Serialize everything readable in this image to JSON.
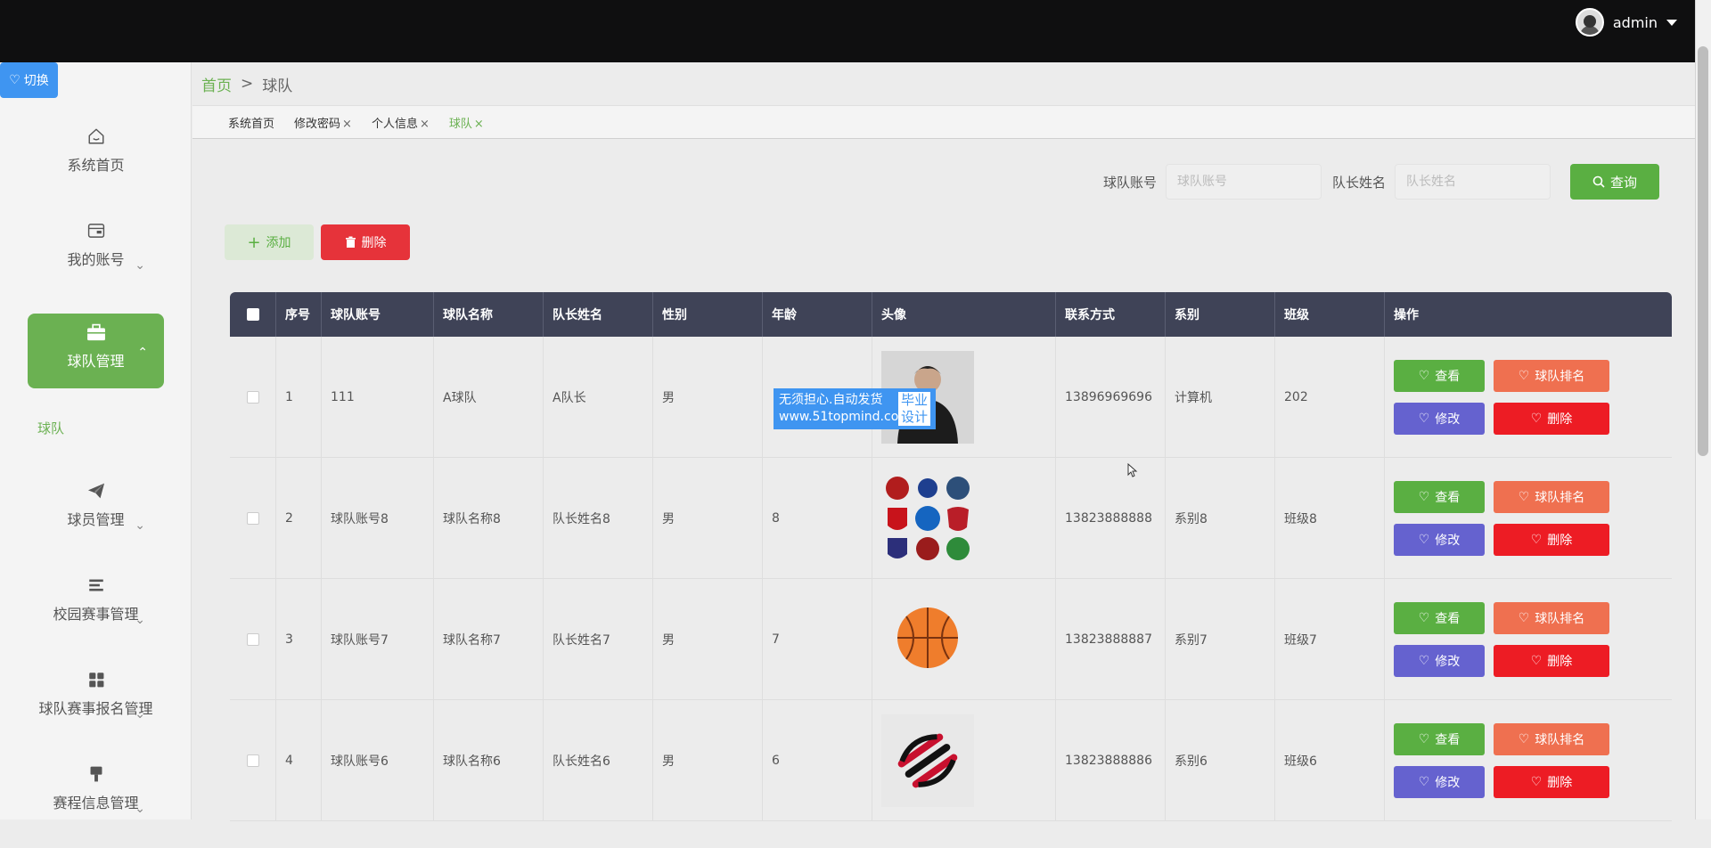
{
  "header": {
    "username": "admin"
  },
  "sidebar": {
    "switch_label": "切换",
    "items": [
      {
        "label": "系统首页",
        "icon": "home-icon"
      },
      {
        "label": "我的账号",
        "icon": "wallet-icon"
      },
      {
        "label": "球队管理",
        "icon": "briefcase-icon",
        "active": true
      },
      {
        "label": "球员管理",
        "icon": "paper-plane-icon"
      },
      {
        "label": "校园赛事管理",
        "icon": "list-icon"
      },
      {
        "label": "球队赛事报名管理",
        "icon": "grid-icon"
      },
      {
        "label": "赛程信息管理",
        "icon": "brush-icon"
      }
    ],
    "submenu": {
      "label": "球队"
    }
  },
  "breadcrumb": {
    "home": "首页",
    "separator": ">",
    "current": "球队"
  },
  "tabs": [
    {
      "label": "系统首页",
      "closable": false
    },
    {
      "label": "修改密码",
      "closable": true
    },
    {
      "label": "个人信息",
      "closable": true
    },
    {
      "label": "球队",
      "closable": true,
      "active": true
    }
  ],
  "search": {
    "account_label": "球队账号",
    "account_placeholder": "球队账号",
    "captain_label": "队长姓名",
    "captain_placeholder": "队长姓名",
    "query_label": "查询"
  },
  "actions": {
    "add_label": "添加",
    "delete_label": "删除"
  },
  "table": {
    "columns": [
      "序号",
      "球队账号",
      "球队名称",
      "队长姓名",
      "性别",
      "年龄",
      "头像",
      "联系方式",
      "系别",
      "班级",
      "操作"
    ],
    "rows": [
      {
        "no": "1",
        "account": "111",
        "name": "A球队",
        "captain": "A队长",
        "gender": "男",
        "age": "",
        "phone": "13896969696",
        "dept": "计算机",
        "class": "202",
        "image": "person"
      },
      {
        "no": "2",
        "account": "球队账号8",
        "name": "球队名称8",
        "captain": "队长姓名8",
        "gender": "男",
        "age": "8",
        "phone": "13823888888",
        "dept": "系别8",
        "class": "班级8",
        "image": "badges"
      },
      {
        "no": "3",
        "account": "球队账号7",
        "name": "球队名称7",
        "captain": "队长姓名7",
        "gender": "男",
        "age": "7",
        "phone": "13823888887",
        "dept": "系别7",
        "class": "班级7",
        "image": "basketball"
      },
      {
        "no": "4",
        "account": "球队账号6",
        "name": "球队名称6",
        "captain": "队长姓名6",
        "gender": "男",
        "age": "6",
        "phone": "13823888886",
        "dept": "系别6",
        "class": "班级6",
        "image": "logo"
      }
    ],
    "ops": {
      "view": "查看",
      "rank": "球队排名",
      "edit": "修改",
      "delete": "删除"
    }
  },
  "watermark": {
    "line1": "无须担心.自动发货",
    "line2": "www.51topmind.com",
    "right_top": "毕业",
    "right_bottom": "设计"
  },
  "colors": {
    "accent": "#6bb152",
    "header_bg": "#0f0f10",
    "table_head": "#3f4357",
    "view": "#5aaf42",
    "rank": "#ef7050",
    "edit": "#6562cf",
    "delete": "#ed1c24"
  }
}
